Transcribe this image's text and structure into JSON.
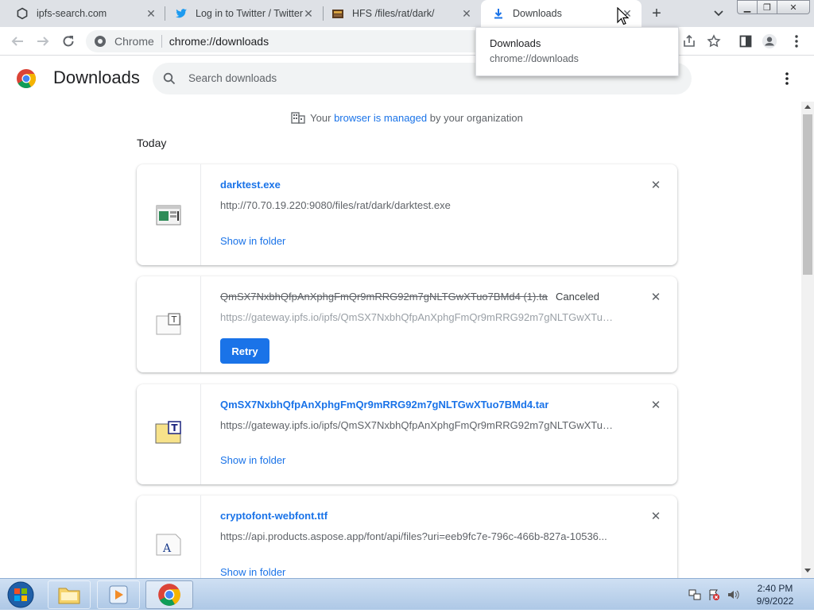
{
  "tabs": [
    {
      "title": "ipfs-search.com",
      "icon": "globe-outline-icon",
      "active": false
    },
    {
      "title": "Log in to Twitter / Twitter",
      "icon": "twitter-bird-icon",
      "active": false
    },
    {
      "title": "HFS /files/rat/dark/",
      "icon": "hfs-icon",
      "active": false
    },
    {
      "title": "Downloads",
      "icon": "download-arrow-icon",
      "active": true
    }
  ],
  "toolbar": {
    "site_label": "Chrome",
    "url": "chrome://downloads"
  },
  "hover_card": {
    "title": "Downloads",
    "url": "chrome://downloads"
  },
  "page": {
    "title": "Downloads",
    "search_placeholder": "Search downloads",
    "managed_prefix": "Your",
    "managed_link": "browser is managed",
    "managed_suffix": "by your organization",
    "section": "Today"
  },
  "downloads": [
    {
      "filename": "darktest.exe",
      "url": "http://70.70.19.220:9080/files/rat/dark/darktest.exe",
      "action": "Show in folder",
      "state": "complete",
      "file_icon": "exe-file-icon"
    },
    {
      "filename": "QmSX7NxbhQfpAnXphgFmQr9mRRG92m7gNLTGwXTuo7BMd4 (1).tar",
      "status": "Canceled",
      "url": "https://gateway.ipfs.io/ipfs/QmSX7NxbhQfpAnXphgFmQr9mRRG92m7gNLTGwXTuo7BMd4...",
      "action": "Retry",
      "state": "canceled",
      "file_icon": "tar-file-icon"
    },
    {
      "filename": "QmSX7NxbhQfpAnXphgFmQr9mRRG92m7gNLTGwXTuo7BMd4.tar",
      "url": "https://gateway.ipfs.io/ipfs/QmSX7NxbhQfpAnXphgFmQr9mRRG92m7gNLTGwXTuo7BMd4...",
      "action": "Show in folder",
      "state": "complete",
      "file_icon": "tar-file-icon"
    },
    {
      "filename": "cryptofont-webfont.ttf",
      "url": "https://api.products.aspose.app/font/api/files?uri=eeb9fc7e-796c-466b-827a-10536...",
      "action": "Show in folder",
      "state": "complete",
      "file_icon": "font-file-icon"
    }
  ],
  "taskbar": {
    "time": "2:40 PM",
    "date": "9/9/2022"
  },
  "colors": {
    "accent": "#1a73e8",
    "tabstrip": "#dee1e6"
  }
}
